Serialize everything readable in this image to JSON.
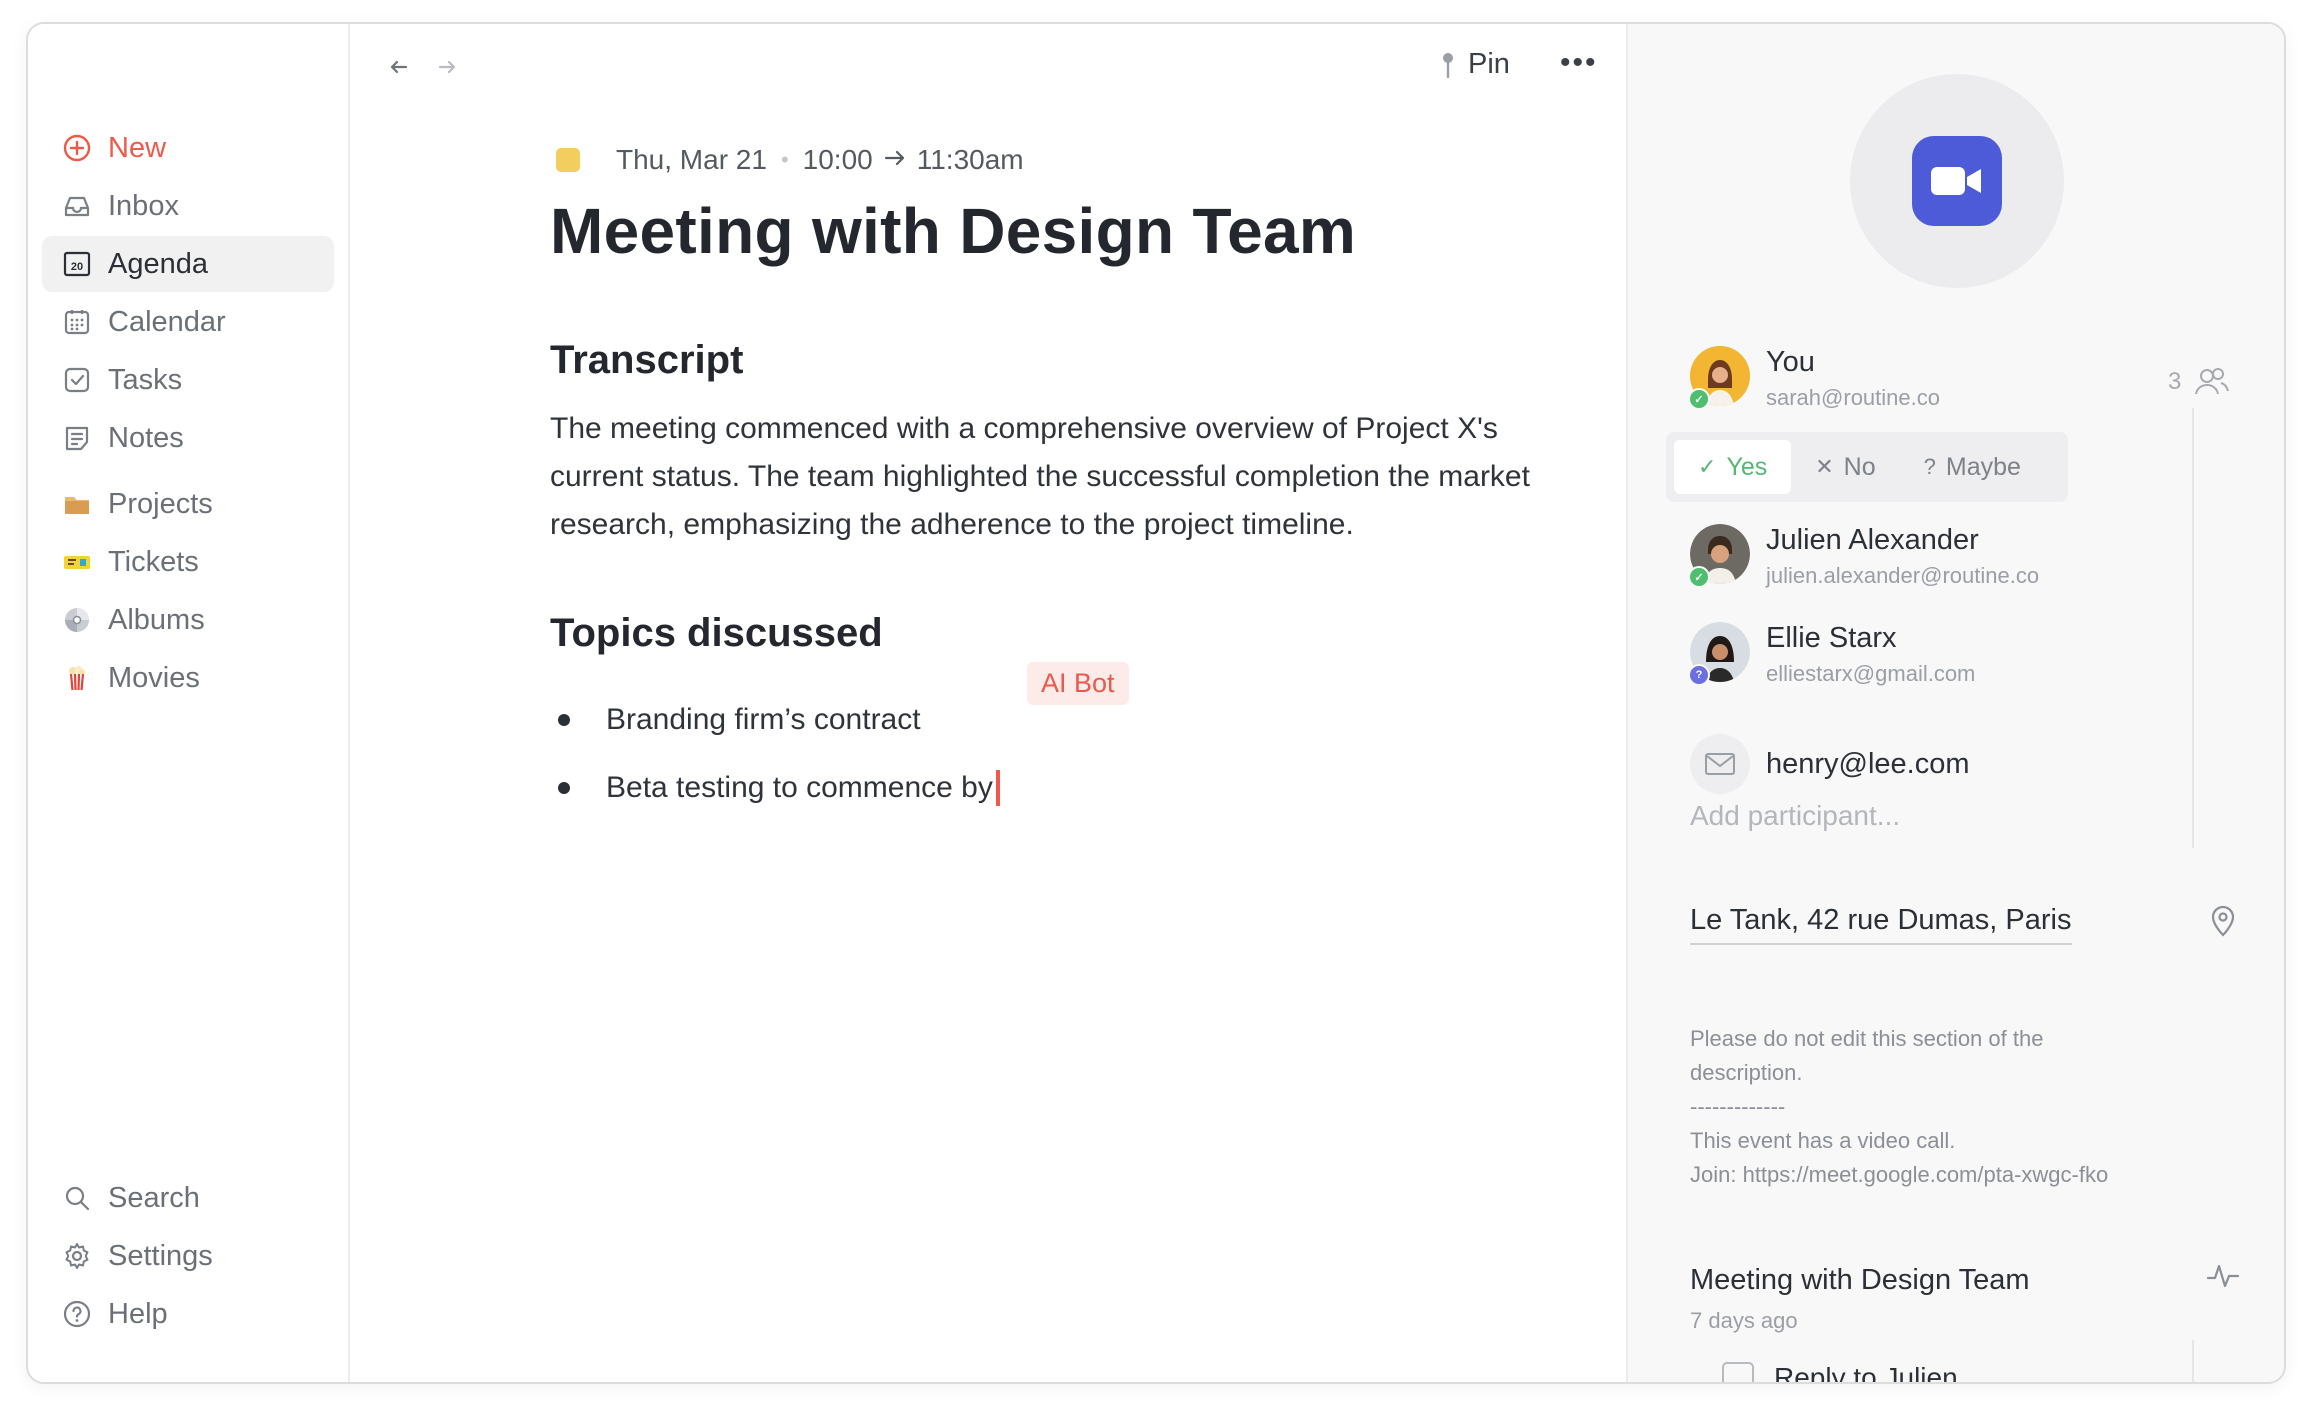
{
  "sidebar": {
    "items": [
      {
        "label": "New",
        "icon": "plus-circle-icon"
      },
      {
        "label": "Inbox",
        "icon": "inbox-icon"
      },
      {
        "label": "Agenda",
        "icon": "agenda-icon",
        "icon_text": "20"
      },
      {
        "label": "Calendar",
        "icon": "calendar-icon"
      },
      {
        "label": "Tasks",
        "icon": "task-check-icon"
      },
      {
        "label": "Notes",
        "icon": "notes-icon"
      },
      {
        "label": "Projects",
        "icon": "folder-icon"
      },
      {
        "label": "Tickets",
        "icon": "ticket-icon"
      },
      {
        "label": "Albums",
        "icon": "disc-icon"
      },
      {
        "label": "Movies",
        "icon": "popcorn-icon"
      }
    ],
    "bottom": [
      {
        "label": "Search",
        "icon": "search-icon"
      },
      {
        "label": "Settings",
        "icon": "gear-icon"
      },
      {
        "label": "Help",
        "icon": "help-icon"
      }
    ]
  },
  "toolbar": {
    "pin_label": "Pin",
    "more_label": "•••"
  },
  "event": {
    "date": "Thu, Mar 21",
    "start": "10:00",
    "end": "11:30am",
    "color": "#f3cd5e",
    "title": "Meeting with Design Team"
  },
  "transcript": {
    "heading": "Transcript",
    "text": "The meeting commenced with a comprehensive overview of Project X's current status. The team highlighted the successful completion the market research, emphasizing the adherence to the project timeline."
  },
  "topics": {
    "heading": "Topics discussed",
    "items": [
      "Branding firm’s contract",
      "Beta testing to commence by"
    ],
    "ai_bot_label": "AI Bot"
  },
  "participants": {
    "count": "3",
    "list": [
      {
        "name": "You",
        "email": "sarah@routine.co",
        "status": "accepted"
      },
      {
        "name": "Julien Alexander",
        "email": "julien.alexander@routine.co",
        "status": "accepted"
      },
      {
        "name": "Ellie Starx",
        "email": "elliestarx@gmail.com",
        "status": "maybe"
      },
      {
        "name": "henry@lee.com",
        "email": "",
        "status": "invited"
      }
    ],
    "rsvp": {
      "yes": "Yes",
      "no": "No",
      "maybe": "Maybe",
      "selected": "yes"
    },
    "add_placeholder": "Add participant..."
  },
  "location": "Le Tank, 42 rue Dumas, Paris",
  "description": {
    "lines": [
      "Please do not edit this section of the description.",
      "-------------",
      "This event has a video call.",
      "Join: https://meet.google.com/pta-xwgc-fko"
    ]
  },
  "related": {
    "title": "Meeting with Design Team",
    "time": "7 days ago",
    "todo": "Reply to Julien"
  },
  "colors": {
    "accent": "#ee5a4a",
    "video": "#4d5bd8",
    "yes": "#54b872"
  }
}
